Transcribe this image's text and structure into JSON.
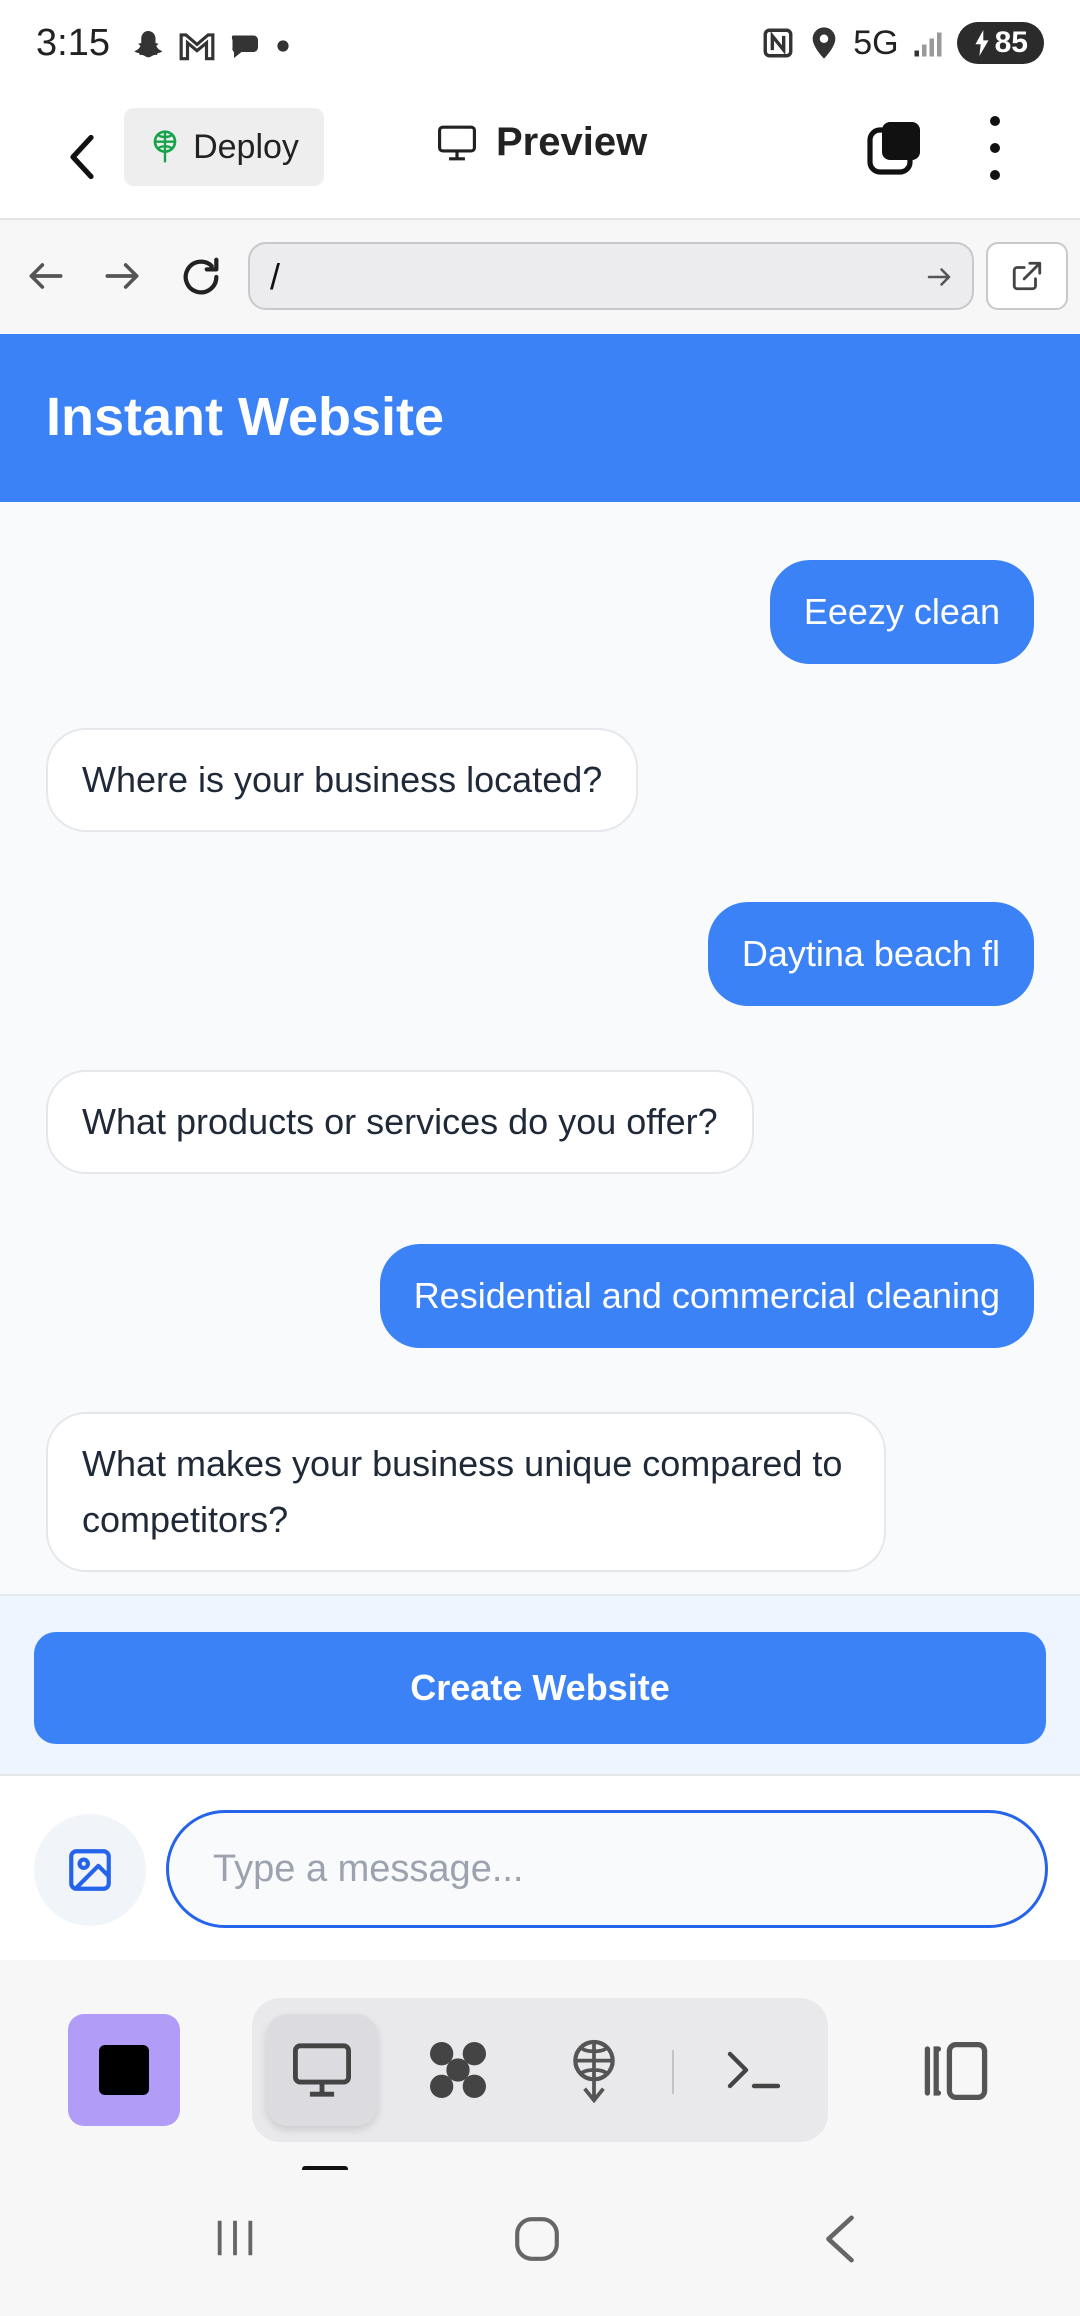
{
  "status_bar": {
    "time": "3:15",
    "network": "5G",
    "battery": "85"
  },
  "app_bar": {
    "deploy_label": "Deploy",
    "preview_label": "Preview"
  },
  "browser": {
    "url": "/"
  },
  "site": {
    "title": "Instant Website"
  },
  "chat": {
    "messages": [
      {
        "role": "user",
        "text": "Eeezy clean"
      },
      {
        "role": "bot",
        "text": "Where is your business located?"
      },
      {
        "role": "user",
        "text": "Daytina beach fl"
      },
      {
        "role": "bot",
        "text": "What products or services do you offer?"
      },
      {
        "role": "user",
        "text": "Residential and commercial cleaning"
      },
      {
        "role": "bot",
        "text": "What makes your business unique compared to competitors?"
      }
    ]
  },
  "actions": {
    "create_label": "Create Website"
  },
  "composer": {
    "placeholder": "Type a message..."
  },
  "colors": {
    "accent": "#3b82f6",
    "stop_button": "#b19cf7"
  }
}
